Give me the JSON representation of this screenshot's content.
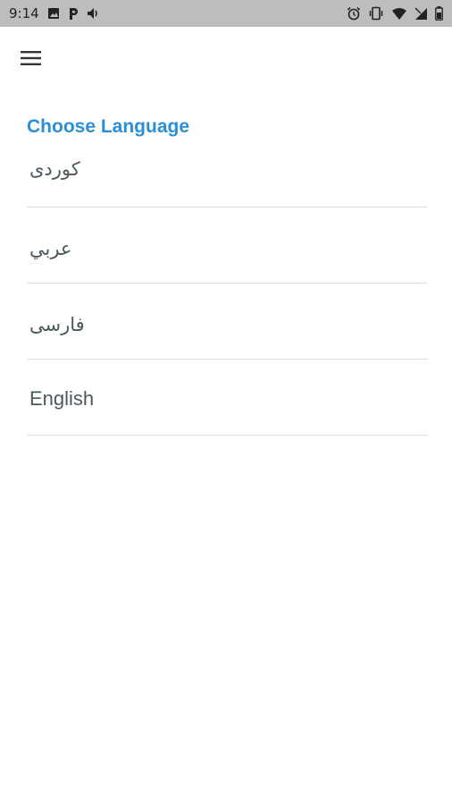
{
  "status_bar": {
    "time": "9:14",
    "left_icons": [
      "image-icon",
      "parking-p-icon",
      "volume-icon"
    ],
    "right_icons": [
      "alarm-icon",
      "vibrate-icon",
      "wifi-icon",
      "signal-icon",
      "battery-icon"
    ]
  },
  "app_bar": {
    "menu_icon": "hamburger-menu-icon"
  },
  "main": {
    "title": "Choose Language",
    "languages": [
      {
        "label": "کوردی"
      },
      {
        "label": "عربي"
      },
      {
        "label": "فارسی"
      },
      {
        "label": "English"
      }
    ]
  },
  "colors": {
    "accent": "#2b8fd8",
    "status_bar_bg": "#bdbdbd",
    "item_text": "#4a5a5c",
    "divider": "#dcdcdc"
  }
}
